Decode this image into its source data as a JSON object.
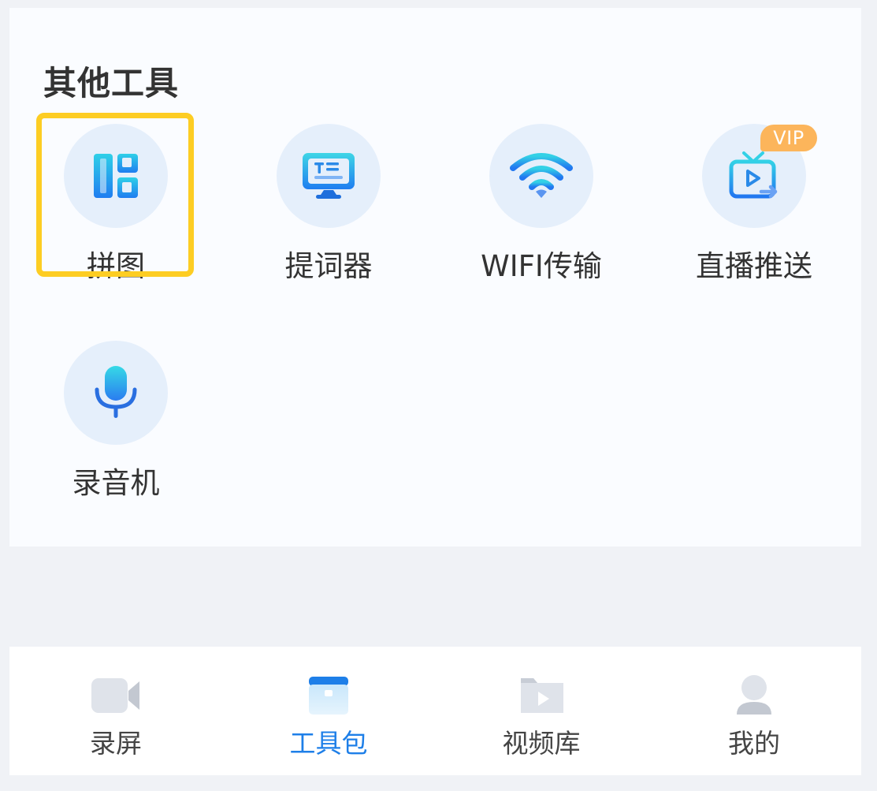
{
  "section": {
    "title": "其他工具"
  },
  "tools": [
    {
      "label": "拼图",
      "icon": "collage-icon"
    },
    {
      "label": "提词器",
      "icon": "teleprompter-icon"
    },
    {
      "label": "WIFI传输",
      "icon": "wifi-icon"
    },
    {
      "label": "直播推送",
      "icon": "live-push-tv-icon",
      "badge": "VIP"
    },
    {
      "label": "录音机",
      "icon": "microphone-icon"
    }
  ],
  "tabbar": {
    "items": [
      {
        "label": "录屏",
        "icon": "video-camera-icon"
      },
      {
        "label": "工具包",
        "icon": "toolbox-icon",
        "active": true
      },
      {
        "label": "视频库",
        "icon": "video-folder-icon"
      },
      {
        "label": "我的",
        "icon": "user-icon"
      }
    ]
  },
  "colors": {
    "accent": "#1e7fe8",
    "highlight": "#fdcd23",
    "vip_badge": "#fcb55b",
    "icon_circle": "#e5effb"
  }
}
